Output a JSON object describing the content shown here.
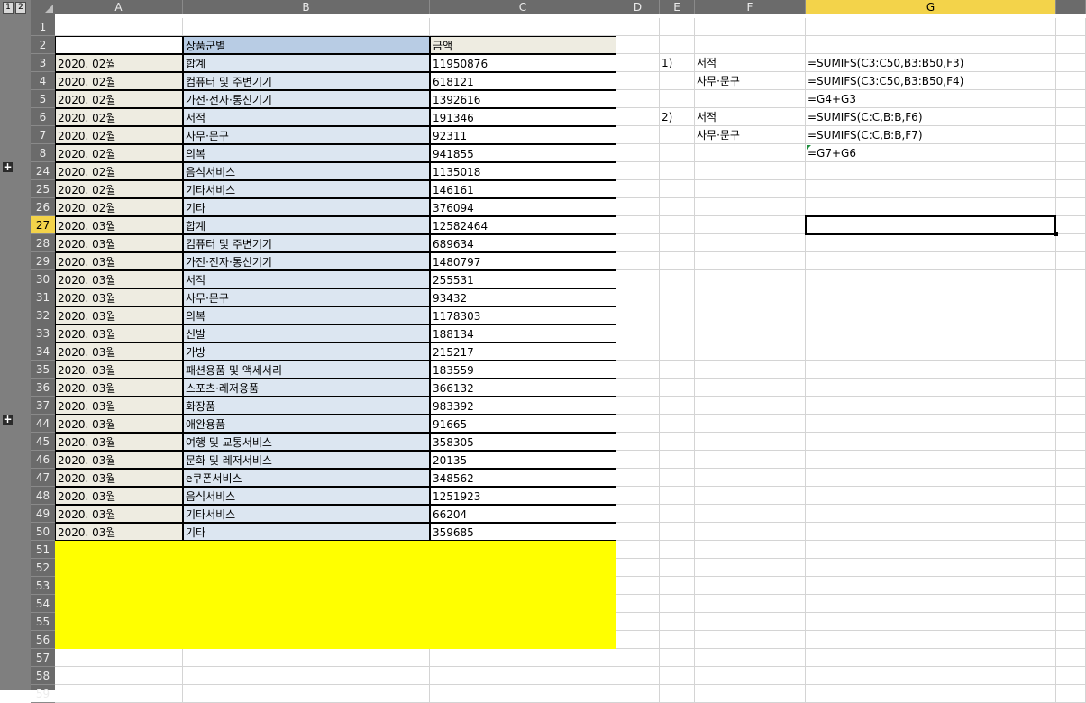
{
  "outline": {
    "level1": "1",
    "level2": "2",
    "expand_symbol": "+"
  },
  "columns": [
    "A",
    "B",
    "C",
    "D",
    "E",
    "F",
    "G"
  ],
  "selected_column": "G",
  "selected_row": "27",
  "rows": [
    {
      "num": "1",
      "a": "",
      "b": "",
      "c": "",
      "e": "",
      "f": "",
      "g": ""
    },
    {
      "num": "2",
      "a": "",
      "b": "상품군별",
      "c": "금액",
      "e": "",
      "f": "",
      "g": ""
    },
    {
      "num": "3",
      "a": "2020. 02월",
      "b": "합계",
      "c": "11950876",
      "e": "1)",
      "f": "서적",
      "g": "=SUMIFS(C3:C50,B3:B50,F3)"
    },
    {
      "num": "4",
      "a": "2020. 02월",
      "b": "컴퓨터 및 주변기기",
      "c": "618121",
      "e": "",
      "f": "사무·문구",
      "g": "=SUMIFS(C3:C50,B3:B50,F4)"
    },
    {
      "num": "5",
      "a": "2020. 02월",
      "b": "가전·전자·통신기기",
      "c": "1392616",
      "e": "",
      "f": "",
      "g": "=G4+G3"
    },
    {
      "num": "6",
      "a": "2020. 02월",
      "b": "서적",
      "c": "191346",
      "e": "2)",
      "f": "서적",
      "g": "=SUMIFS(C:C,B:B,F6)"
    },
    {
      "num": "7",
      "a": "2020. 02월",
      "b": "사무·문구",
      "c": "92311",
      "e": "",
      "f": "사무·문구",
      "g": "=SUMIFS(C:C,B:B,F7)"
    },
    {
      "num": "8",
      "a": "2020. 02월",
      "b": "의복",
      "c": "941855",
      "e": "",
      "f": "",
      "g": "=G7+G6"
    },
    {
      "num": "24",
      "a": "2020. 02월",
      "b": "음식서비스",
      "c": "1135018",
      "e": "",
      "f": "",
      "g": ""
    },
    {
      "num": "25",
      "a": "2020. 02월",
      "b": "기타서비스",
      "c": "146161",
      "e": "",
      "f": "",
      "g": ""
    },
    {
      "num": "26",
      "a": "2020. 02월",
      "b": "기타",
      "c": "376094",
      "e": "",
      "f": "",
      "g": ""
    },
    {
      "num": "27",
      "a": "2020. 03월",
      "b": "합계",
      "c": "12582464",
      "e": "",
      "f": "",
      "g": ""
    },
    {
      "num": "28",
      "a": "2020. 03월",
      "b": "컴퓨터 및 주변기기",
      "c": "689634",
      "e": "",
      "f": "",
      "g": ""
    },
    {
      "num": "29",
      "a": "2020. 03월",
      "b": "가전·전자·통신기기",
      "c": "1480797",
      "e": "",
      "f": "",
      "g": ""
    },
    {
      "num": "30",
      "a": "2020. 03월",
      "b": "서적",
      "c": "255531",
      "e": "",
      "f": "",
      "g": ""
    },
    {
      "num": "31",
      "a": "2020. 03월",
      "b": "사무·문구",
      "c": "93432",
      "e": "",
      "f": "",
      "g": ""
    },
    {
      "num": "32",
      "a": "2020. 03월",
      "b": "의복",
      "c": "1178303",
      "e": "",
      "f": "",
      "g": ""
    },
    {
      "num": "33",
      "a": "2020. 03월",
      "b": "신발",
      "c": "188134",
      "e": "",
      "f": "",
      "g": ""
    },
    {
      "num": "34",
      "a": "2020. 03월",
      "b": "가방",
      "c": "215217",
      "e": "",
      "f": "",
      "g": ""
    },
    {
      "num": "35",
      "a": "2020. 03월",
      "b": "패션용품 및 액세서리",
      "c": "183559",
      "e": "",
      "f": "",
      "g": ""
    },
    {
      "num": "36",
      "a": "2020. 03월",
      "b": "스포츠·레저용품",
      "c": "366132",
      "e": "",
      "f": "",
      "g": ""
    },
    {
      "num": "37",
      "a": "2020. 03월",
      "b": "화장품",
      "c": "983392",
      "e": "",
      "f": "",
      "g": ""
    },
    {
      "num": "44",
      "a": "2020. 03월",
      "b": "애완용품",
      "c": "91665",
      "e": "",
      "f": "",
      "g": ""
    },
    {
      "num": "45",
      "a": "2020. 03월",
      "b": "여행 및 교통서비스",
      "c": "358305",
      "e": "",
      "f": "",
      "g": ""
    },
    {
      "num": "46",
      "a": "2020. 03월",
      "b": "문화 및 레저서비스",
      "c": "20135",
      "e": "",
      "f": "",
      "g": ""
    },
    {
      "num": "47",
      "a": "2020. 03월",
      "b": "e쿠폰서비스",
      "c": "348562",
      "e": "",
      "f": "",
      "g": ""
    },
    {
      "num": "48",
      "a": "2020. 03월",
      "b": "음식서비스",
      "c": "1251923",
      "e": "",
      "f": "",
      "g": ""
    },
    {
      "num": "49",
      "a": "2020. 03월",
      "b": "기타서비스",
      "c": "66204",
      "e": "",
      "f": "",
      "g": ""
    },
    {
      "num": "50",
      "a": "2020. 03월",
      "b": "기타",
      "c": "359685",
      "e": "",
      "f": "",
      "g": ""
    },
    {
      "num": "51",
      "a": "",
      "b": "",
      "c": "",
      "e": "",
      "f": "",
      "g": ""
    },
    {
      "num": "52",
      "a": "",
      "b": "",
      "c": "",
      "e": "",
      "f": "",
      "g": ""
    },
    {
      "num": "53",
      "a": "",
      "b": "",
      "c": "",
      "e": "",
      "f": "",
      "g": ""
    },
    {
      "num": "54",
      "a": "",
      "b": "",
      "c": "",
      "e": "",
      "f": "",
      "g": ""
    },
    {
      "num": "55",
      "a": "",
      "b": "",
      "c": "",
      "e": "",
      "f": "",
      "g": ""
    },
    {
      "num": "56",
      "a": "",
      "b": "",
      "c": "",
      "e": "",
      "f": "",
      "g": ""
    },
    {
      "num": "57",
      "a": "",
      "b": "",
      "c": "",
      "e": "",
      "f": "",
      "g": ""
    },
    {
      "num": "58",
      "a": "",
      "b": "",
      "c": "",
      "e": "",
      "f": "",
      "g": ""
    },
    {
      "num": "59",
      "a": "",
      "b": "",
      "c": "",
      "e": "",
      "f": "",
      "g": ""
    }
  ],
  "colors": {
    "header_b": "#b8cce4",
    "header_c": "#eeece1",
    "feb_a": "#eeece1",
    "mar_a": "#f2dcdb",
    "col_b": "#dce6f1",
    "highlight": "#ffff00",
    "selected_header": "#f3d34a"
  }
}
